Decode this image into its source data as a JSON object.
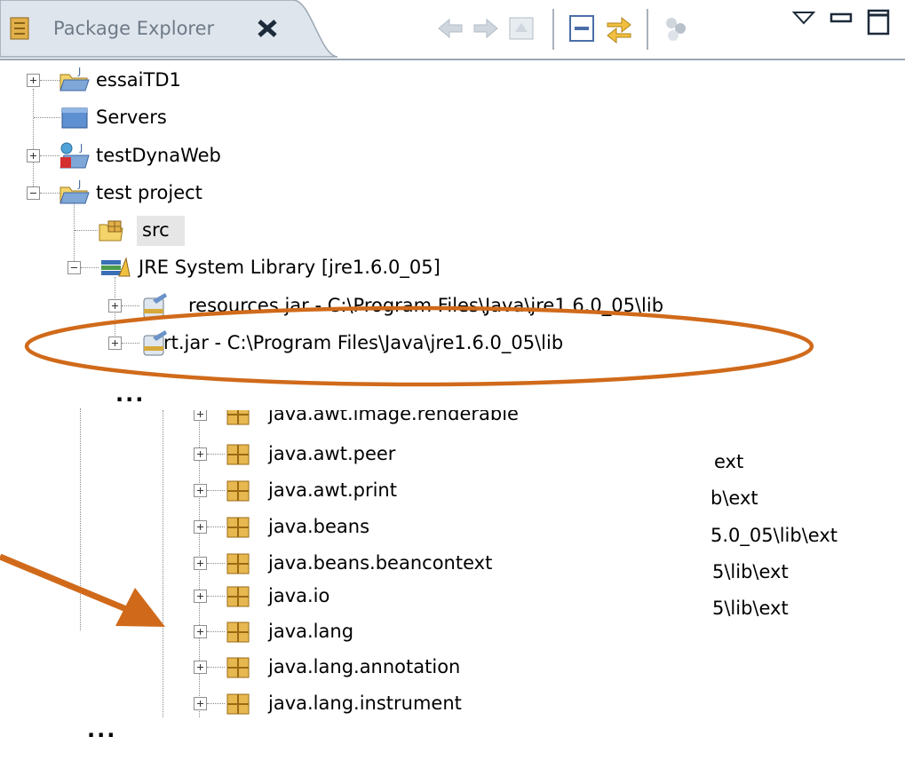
{
  "view": {
    "tab_title": "Package Explorer",
    "toolbar": [
      "back-icon",
      "forward-icon",
      "up-icon",
      "collapse-all-icon",
      "link-with-editor-icon",
      "filters-icon",
      "view-menu-icon",
      "minimize-icon",
      "maximize-icon"
    ]
  },
  "tree": {
    "projects": [
      {
        "label": "essaiTD1",
        "expanded": false
      },
      {
        "label": "Servers",
        "expanded": false
      },
      {
        "label": "testDynaWeb",
        "expanded": false
      },
      {
        "label": "test project",
        "expanded": true
      }
    ],
    "src": "src",
    "jre": "JRE System Library [jre1.6.0_05]",
    "jars": [
      "resources.jar - C:\\Program Files\\Java\\jre1.6.0_05\\lib",
      "rt.jar - C:\\Program Files\\Java\\jre1.6.0_05\\lib"
    ],
    "ellipsis": "...",
    "packages": [
      "java.awt.image.renderable",
      "java.awt.peer",
      "java.awt.print",
      "java.beans",
      "java.beans.beancontext",
      "java.io",
      "java.lang",
      "java.lang.annotation",
      "java.lang.instrument"
    ],
    "truncated_paths": [
      "ext",
      "b\\ext",
      "5.0_05\\lib\\ext",
      "5\\lib\\ext",
      "5\\lib\\ext"
    ],
    "ellipsis_bottom": "..."
  },
  "annotations": {
    "highlight_color": "#d06a1a"
  }
}
